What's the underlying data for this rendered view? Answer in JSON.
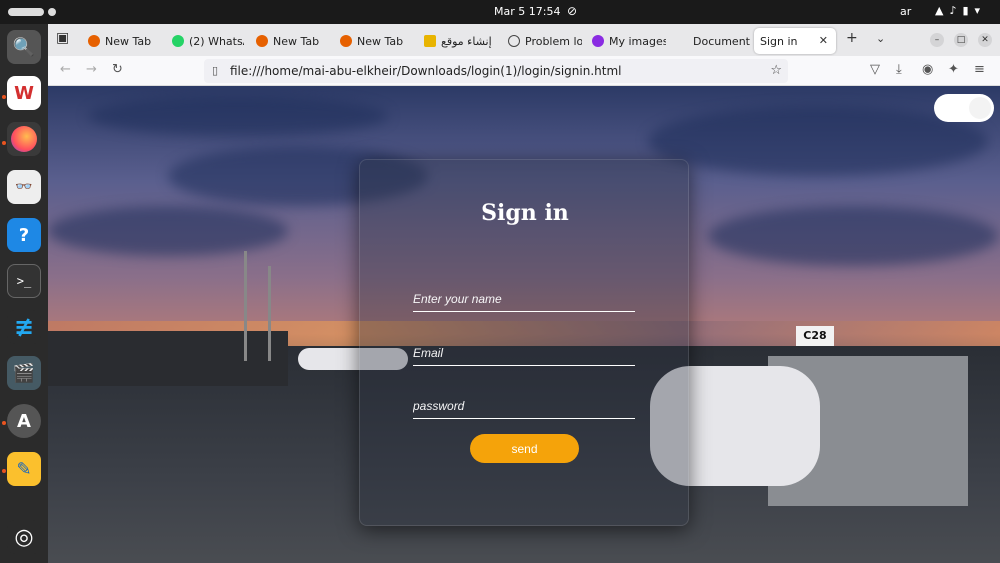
{
  "system_bar": {
    "clock": "Mar 5  17:54",
    "lang": "ar"
  },
  "dock": {
    "apps": [
      "Search",
      "WPS Office",
      "Firefox",
      "Document Viewer",
      "Help",
      "Terminal",
      "VS Code",
      "Video Player",
      "App Center",
      "Text Editor",
      "Ubuntu"
    ]
  },
  "tabs": [
    {
      "label": "New Tab",
      "color": "#e66000"
    },
    {
      "label": "(2) WhatsA",
      "color": "#25d366"
    },
    {
      "label": "New Tab",
      "color": "#e66000"
    },
    {
      "label": "New Tab",
      "color": "#e66000"
    },
    {
      "label": "إنشاء موقع",
      "color": "#e8b400"
    },
    {
      "label": "Problem lo",
      "color": "#444444"
    },
    {
      "label": "My images",
      "color": "#8a2be2"
    },
    {
      "label": "Document",
      "color": "#cccccc"
    },
    {
      "label": "Sign in",
      "color": "#ffffff",
      "active": true
    }
  ],
  "url": "file:///home/mai-abu-elkheir/Downloads/login(1)/login/signin.html",
  "form": {
    "title": "Sign in",
    "name_placeholder": "Enter your name",
    "email_placeholder": "Email",
    "password_placeholder": "password",
    "send_label": "send",
    "accent": "#f5a30a"
  }
}
